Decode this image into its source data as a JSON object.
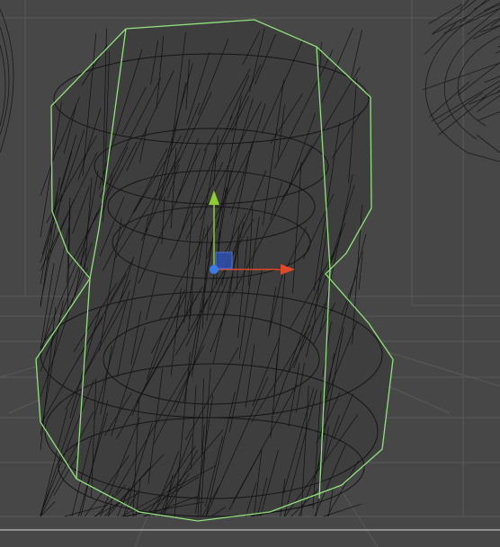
{
  "viewport": {
    "mode": "wireframe-scene-view",
    "background_color": "#474747",
    "grid_color": "#5a5a5a",
    "wire_color": "#111111",
    "selection_outline_color": "#8fe37a"
  },
  "objects": [
    {
      "name": "selected-mesh",
      "selected": true
    },
    {
      "name": "left-mesh",
      "selected": false
    },
    {
      "name": "right-mesh",
      "selected": false
    }
  ],
  "gizmo": {
    "type": "move-tool",
    "x_axis_color": "#e0482a",
    "y_axis_color": "#8ccf2e",
    "z_axis_color": "#3a7ce6",
    "center_handle_color": "#2f4fb0"
  }
}
